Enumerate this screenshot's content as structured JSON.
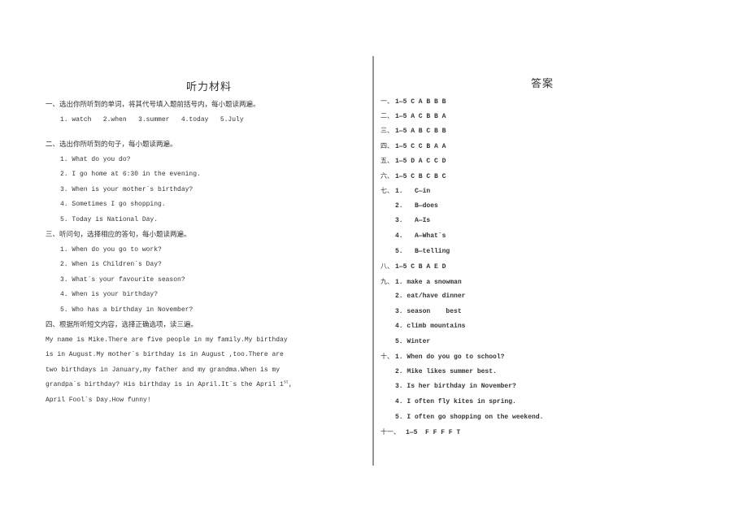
{
  "left": {
    "title": "听力材料",
    "sec1": {
      "heading": "一、选出你所听到的单词，将其代号填入题前括号内，每小题读两遍。",
      "items": "1. watch   2.when   3.summer   4.today   5.July"
    },
    "sec2": {
      "heading": "二、选出你所听到的句子，每小题读两遍。",
      "items": [
        "1. What do you do?",
        "2. I go home at 6:30 in the evening.",
        "3. When is your mother`s birthday?",
        "4. Sometimes I go shopping.",
        "5. Today is National Day."
      ]
    },
    "sec3": {
      "heading": "三、听问句，选择相应的答句，每小题读两遍。",
      "items": [
        "1. When do you go to work?",
        "2. When is Children`s Day?",
        "3. What`s your favourite season?",
        "4. When is your birthday?",
        "5. Who has a birthday in November?"
      ]
    },
    "sec4": {
      "heading": "四、根据所听短文内容，选择正确选项，读三遍。",
      "lines": [
        "My name is Mike.There are five people in my family.My birthday",
        "is in August.My mother`s birthday is in August ,too.There are",
        "two birthdays in January,my father and my grandma.When is my",
        "grandpa`s birthday? His birthday is in April.It`s the April 1",
        "April Fool`s Day.How funny!"
      ],
      "sup": "st",
      "after_sup": ","
    }
  },
  "right": {
    "title": "答案",
    "answers": [
      {
        "prefix": "一、",
        "text": "1—5 C A B B B"
      },
      {
        "prefix": "二、",
        "text": "1—5 A C B B A"
      },
      {
        "prefix": "三、",
        "text": "1—5 A B C B B"
      },
      {
        "prefix": "四、",
        "text": "1—5 C C B A A"
      },
      {
        "prefix": "五、",
        "text": "1—5 D A C C D"
      },
      {
        "prefix": "六、",
        "text": "1—5 C B C B C"
      },
      {
        "prefix": "七、",
        "text": "1.   C—in"
      },
      {
        "prefix": "",
        "text": "2.   B—does"
      },
      {
        "prefix": "",
        "text": "3.   A—Is"
      },
      {
        "prefix": "",
        "text": "4.   A—What`s"
      },
      {
        "prefix": "",
        "text": "5.   B—telling"
      },
      {
        "prefix": "八、",
        "text": "1—5 C B A E D"
      },
      {
        "prefix": "九、",
        "text": "1. make a snowman"
      },
      {
        "prefix": "",
        "text": "2. eat/have dinner"
      },
      {
        "prefix": "",
        "text": "3. season    best"
      },
      {
        "prefix": "",
        "text": "4. climb mountains"
      },
      {
        "prefix": "",
        "text": "5. Winter"
      },
      {
        "prefix": "十、",
        "text": "1. When do you go to school?"
      },
      {
        "prefix": "",
        "text": "2. Mike likes summer best."
      },
      {
        "prefix": "",
        "text": "3. Is her birthday in November?"
      },
      {
        "prefix": "",
        "text": "4. I often fly kites in spring."
      },
      {
        "prefix": "",
        "text": "5. I often go shopping on the weekend."
      },
      {
        "prefix": "十一、",
        "text": "1—5  F F F F T"
      }
    ]
  }
}
